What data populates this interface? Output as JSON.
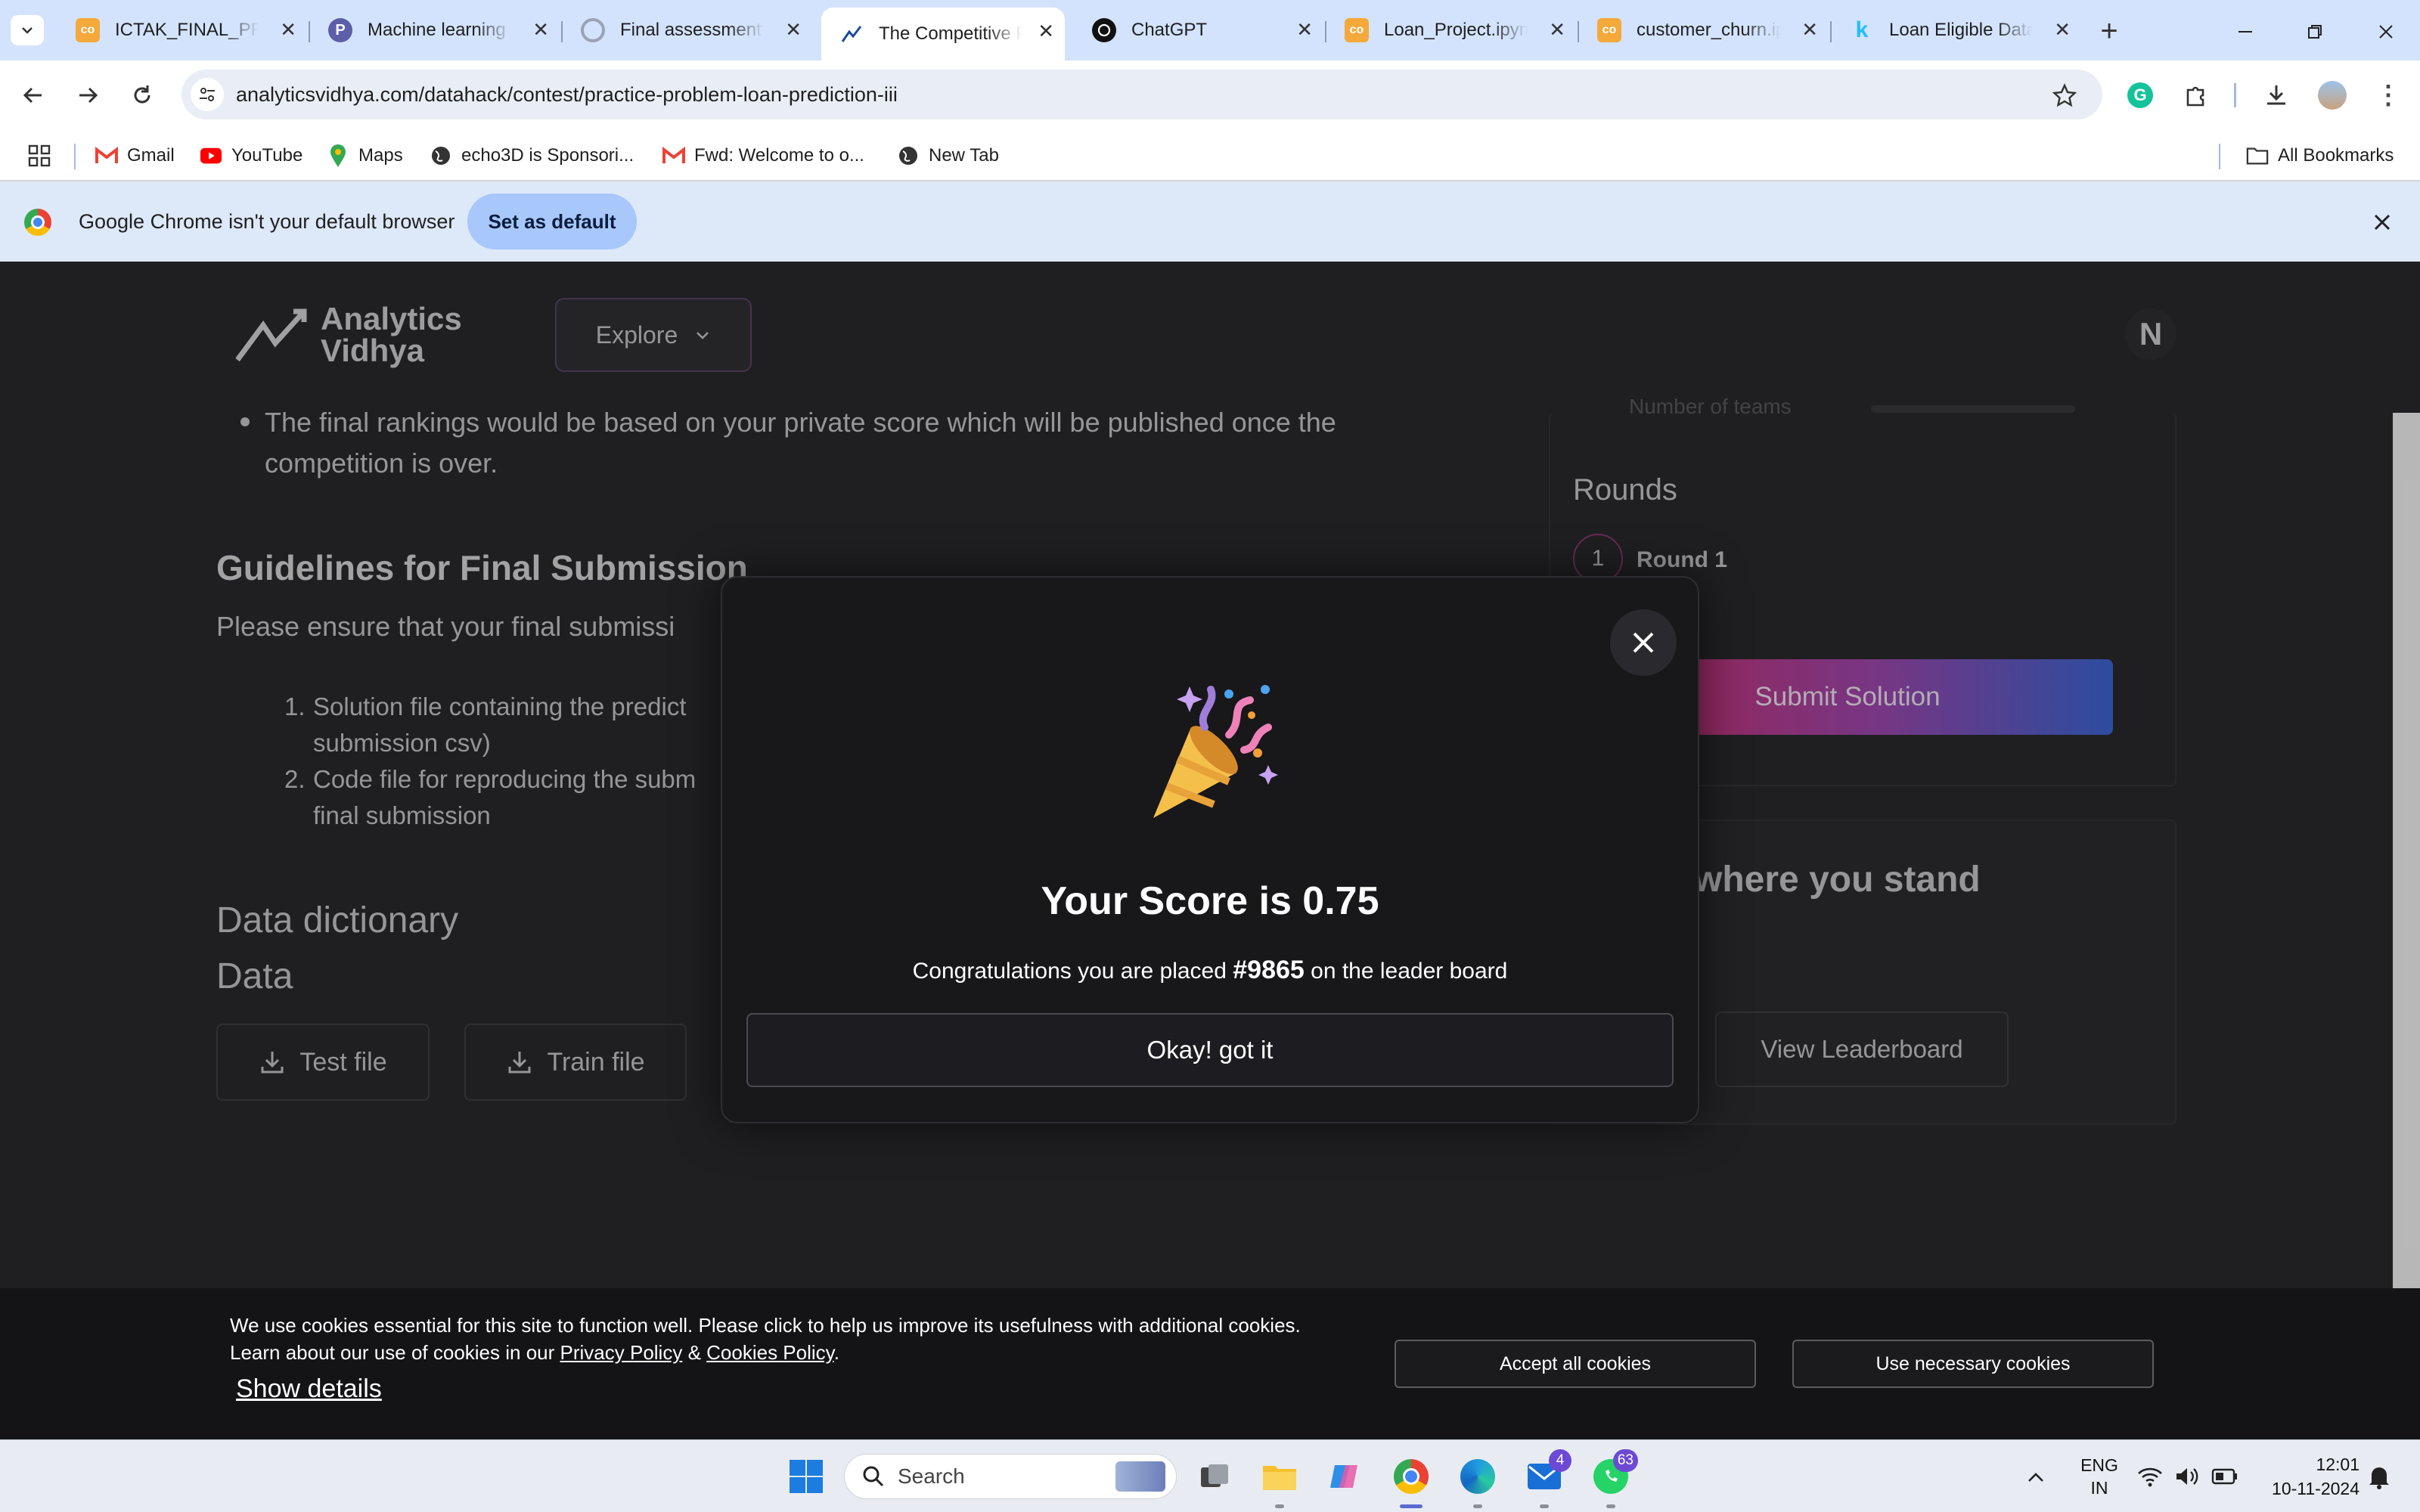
{
  "browser": {
    "tabs": [
      {
        "title": "ICTAK_FINAL_PRO",
        "icon": "jupyter-icon"
      },
      {
        "title": "Machine learning",
        "icon": "perplexity-icon"
      },
      {
        "title": "Final assessment c",
        "icon": "loading-icon"
      },
      {
        "title": "The Competitive P",
        "icon": "analytics-vidhya-icon",
        "active": true
      },
      {
        "title": "ChatGPT",
        "icon": "chatgpt-icon"
      },
      {
        "title": "Loan_Project.ipynb",
        "icon": "jupyter-icon"
      },
      {
        "title": "customer_churn.ip",
        "icon": "jupyter-icon"
      },
      {
        "title": "Loan Eligible Data",
        "icon": "kaggle-icon"
      }
    ],
    "url": "analyticsvidhya.com/datahack/contest/practice-problem-loan-prediction-iii",
    "bookmarks": [
      {
        "label": "Gmail",
        "icon": "gmail-icon"
      },
      {
        "label": "YouTube",
        "icon": "youtube-icon"
      },
      {
        "label": "Maps",
        "icon": "maps-icon"
      },
      {
        "label": "echo3D is Sponsori...",
        "icon": "globe-icon"
      },
      {
        "label": "Fwd: Welcome to o...",
        "icon": "gmail-icon"
      },
      {
        "label": "New Tab",
        "icon": "globe-icon"
      }
    ],
    "all_bookmarks": "All Bookmarks",
    "infobar": {
      "message": "Google Chrome isn't your default browser",
      "button": "Set as default"
    }
  },
  "site": {
    "logo_line1": "Analytics",
    "logo_line2": "Vidhya",
    "explore": "Explore",
    "avatar": "N"
  },
  "content": {
    "ranking_bullet": "The final rankings would be based on your private score which will be published once the competition is over.",
    "guidelines_heading": "Guidelines for Final Submission",
    "guidelines_intro": "Please ensure that your final submissi",
    "list_item1_line1": "Solution file containing the predict",
    "list_item1_line2": "submission csv)",
    "list_item2_line1": "Code file for reproducing the subm",
    "list_item2_line2": "final submission",
    "data_dictionary": "Data dictionary",
    "data": "Data",
    "test_file": "Test file",
    "train_file": "Train file"
  },
  "sidebar": {
    "teams_label": "Number of teams",
    "rounds_heading": "Rounds",
    "round_number": "1",
    "round_label": "Round 1",
    "submit": "Submit Solution",
    "stand_heading": "where you stand",
    "leaderboard": "View Leaderboard"
  },
  "modal": {
    "score_title": "Your Score is 0.75",
    "congrats_prefix": "Congratulations you are placed ",
    "rank": "#9865",
    "congrats_suffix": " on the leader board",
    "ok_button": "Okay! got it"
  },
  "cookie": {
    "line1": "We use cookies essential for this site to function well. Please click to help us improve its usefulness with additional cookies.",
    "line2_prefix": "Learn about our use of cookies in our ",
    "privacy": "Privacy Policy",
    "amp": " & ",
    "cookies_policy": "Cookies Policy",
    "period": ".",
    "show_details": "Show details",
    "accept_all": "Accept all cookies",
    "use_necessary": "Use necessary cookies"
  },
  "taskbar": {
    "search": "Search",
    "mail_badge": "4",
    "whatsapp_badge": "63",
    "lang1": "ENG",
    "lang2": "IN",
    "time": "12:01",
    "date": "10-11-2024"
  },
  "colors": {
    "accent_start": "#e0305f",
    "accent_end": "#3d64d6",
    "page_bg": "#2a2a2d"
  }
}
